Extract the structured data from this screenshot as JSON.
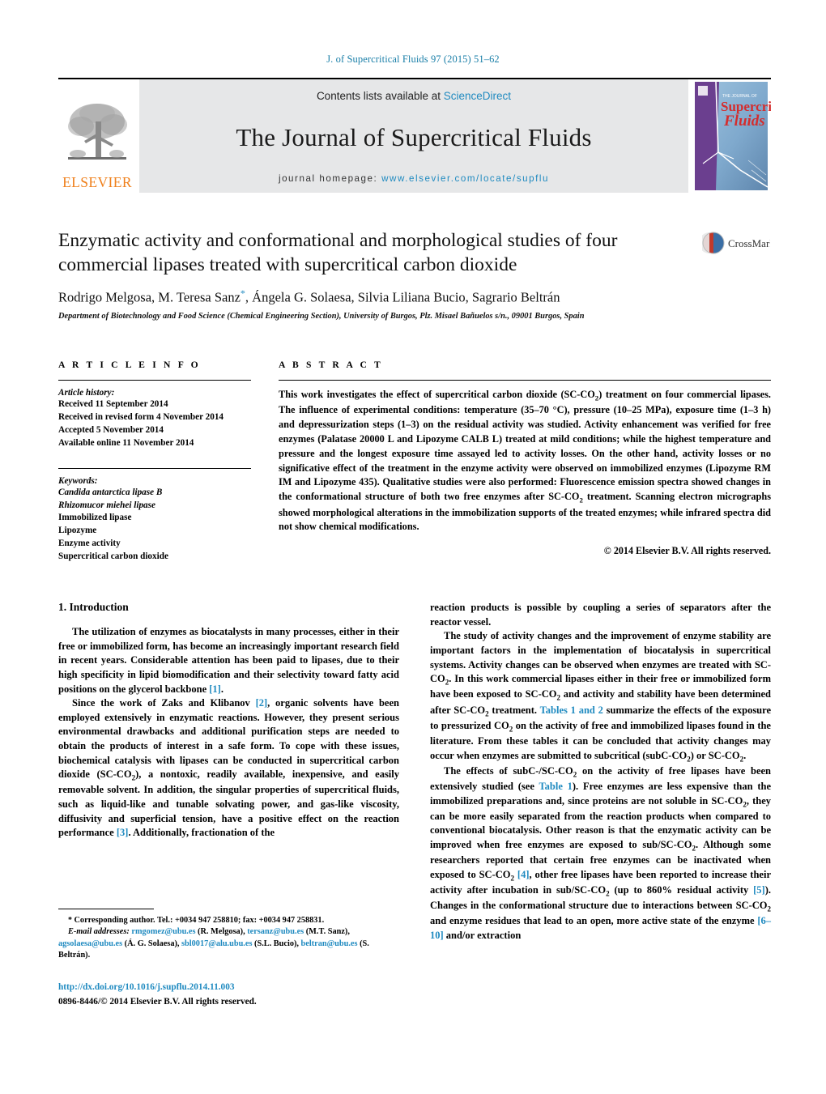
{
  "running_head": "J. of Supercritical Fluids 97 (2015) 51–62",
  "masthead": {
    "publisher_name": "ELSEVIER",
    "contents_prefix": "Contents lists available at ",
    "contents_link": "ScienceDirect",
    "journal_name": "The Journal of Supercritical Fluids",
    "homepage_prefix": "journal homepage: ",
    "homepage_url": "www.elsevier.com/locate/supflu",
    "cover_line1": "THE JOURNAL OF",
    "cover_line2": "Supercritical",
    "cover_line3": "Fluids"
  },
  "article": {
    "title": "Enzymatic activity and conformational and morphological studies of four commercial lipases treated with supercritical carbon dioxide",
    "authors": "Rodrigo Melgosa, M. Teresa Sanz",
    "authors_rest": ", Ángela G. Solaesa, Silvia Liliana Bucio, Sagrario Beltrán",
    "corresponding_marker": "*",
    "affiliation": "Department of Biotechnology and Food Science (Chemical Engineering Section), University of Burgos, Plz. Misael Bañuelos s/n., 09001 Burgos, Spain",
    "crossmark_label": "CrossMark"
  },
  "article_info": {
    "heading": "A R T I C L E   I N F O",
    "history_label": "Article history:",
    "history": [
      "Received 11 September 2014",
      "Received in revised form 4 November 2014",
      "Accepted 5 November 2014",
      "Available online 11 November 2014"
    ],
    "keywords_label": "Keywords:",
    "keywords": [
      "Candida antarctica lipase B",
      "Rhizomucor miehei lipase",
      "Immobilized lipase",
      "Lipozyme",
      "Enzyme activity",
      "Supercritical carbon dioxide"
    ]
  },
  "abstract": {
    "heading": "A B S T R A C T",
    "text": "This work investigates the effect of supercritical carbon dioxide (SC-CO2) treatment on four commercial lipases. The influence of experimental conditions: temperature (35–70 °C), pressure (10–25 MPa), exposure time (1–3 h) and depressurization steps (1–3) on the residual activity was studied. Activity enhancement was verified for free enzymes (Palatase 20000 L and Lipozyme CALB L) treated at mild conditions; while the highest temperature and pressure and the longest exposure time assayed led to activity losses. On the other hand, activity losses or no significative effect of the treatment in the enzyme activity were observed on immobilized enzymes (Lipozyme RM IM and Lipozyme 435). Qualitative studies were also performed: Fluorescence emission spectra showed changes in the conformational structure of both two free enzymes after SC-CO2 treatment. Scanning electron micrographs showed morphological alterations in the immobilization supports of the treated enzymes; while infrared spectra did not show chemical modifications.",
    "copyright": "© 2014 Elsevier B.V. All rights reserved."
  },
  "introduction": {
    "section_number_title": "1. Introduction",
    "left_paragraphs": [
      "The utilization of enzymes as biocatalysts in many processes, either in their free or immobilized form, has become an increasingly important research field in recent years. Considerable attention has been paid to lipases, due to their high specificity in lipid biomodification and their selectivity toward fatty acid positions on the glycerol backbone [1].",
      "Since the work of Zaks and Klibanov [2], organic solvents have been employed extensively in enzymatic reactions. However, they present serious environmental drawbacks and additional purification steps are needed to obtain the products of interest in a safe form. To cope with these issues, biochemical catalysis with lipases can be conducted in supercritical carbon dioxide (SC-CO2), a nontoxic, readily available, inexpensive, and easily removable solvent. In addition, the singular properties of supercritical fluids, such as liquid-like and tunable solvating power, and gas-like viscosity, diffusivity and superficial tension, have a positive effect on the reaction performance [3]. Additionally, fractionation of the"
    ],
    "right_paragraphs": [
      "reaction products is possible by coupling a series of separators after the reactor vessel.",
      "The study of activity changes and the improvement of enzyme stability are important factors in the implementation of biocatalysis in supercritical systems. Activity changes can be observed when enzymes are treated with SC-CO2. In this work commercial lipases either in their free or immobilized form have been exposed to SC-CO2 and activity and stability have been determined after SC-CO2 treatment. Tables 1 and 2 summarize the effects of the exposure to pressurized CO2 on the activity of free and immobilized lipases found in the literature. From these tables it can be concluded that activity changes may occur when enzymes are submitted to subcritical (subC-CO2) or SC-CO2.",
      "The effects of subC-/SC-CO2 on the activity of free lipases have been extensively studied (see Table 1). Free enzymes are less expensive than the immobilized preparations and, since proteins are not soluble in SC-CO2, they can be more easily separated from the reaction products when compared to conventional biocatalysis. Other reason is that the enzymatic activity can be improved when free enzymes are exposed to sub/SC-CO2. Although some researchers reported that certain free enzymes can be inactivated when exposed to SC-CO2 [4], other free lipases have been reported to increase their activity after incubation in sub/SC-CO2 (up to 860% residual activity [5]). Changes in the conformational structure due to interactions between SC-CO2 and enzyme residues that lead to an open, more active state of the enzyme [6–10] and/or extraction"
    ]
  },
  "footnotes": {
    "corresponding": "Corresponding author. Tel.: +0034 947 258810; fax: +0034 947 258831.",
    "email_label": "E-mail addresses:",
    "emails": [
      {
        "address": "rmgomez@ubu.es",
        "owner": "(R. Melgosa),"
      },
      {
        "address": "tersanz@ubu.es",
        "owner": "(M.T. Sanz),"
      },
      {
        "address": "agsolaesa@ubu.es",
        "owner": "(Á. G. Solaesa),"
      },
      {
        "address": "sbl0017@alu.ubu.es",
        "owner": "(S.L. Bucio),"
      },
      {
        "address": "beltran@ubu.es",
        "owner": "(S. Beltrán)."
      }
    ],
    "doi": "http://dx.doi.org/10.1016/j.supflu.2014.11.003",
    "issn_copyright": "0896-8446/© 2014 Elsevier B.V. All rights reserved."
  },
  "colors": {
    "link_blue": "#1f8ac0",
    "elsevier_orange": "#ef7f1a",
    "banner_grey": "#e6e7e8",
    "cover_purple": "#6b3f8f",
    "cover_blue": "#8fb9d9",
    "crossmark_red": "#c0392b"
  }
}
